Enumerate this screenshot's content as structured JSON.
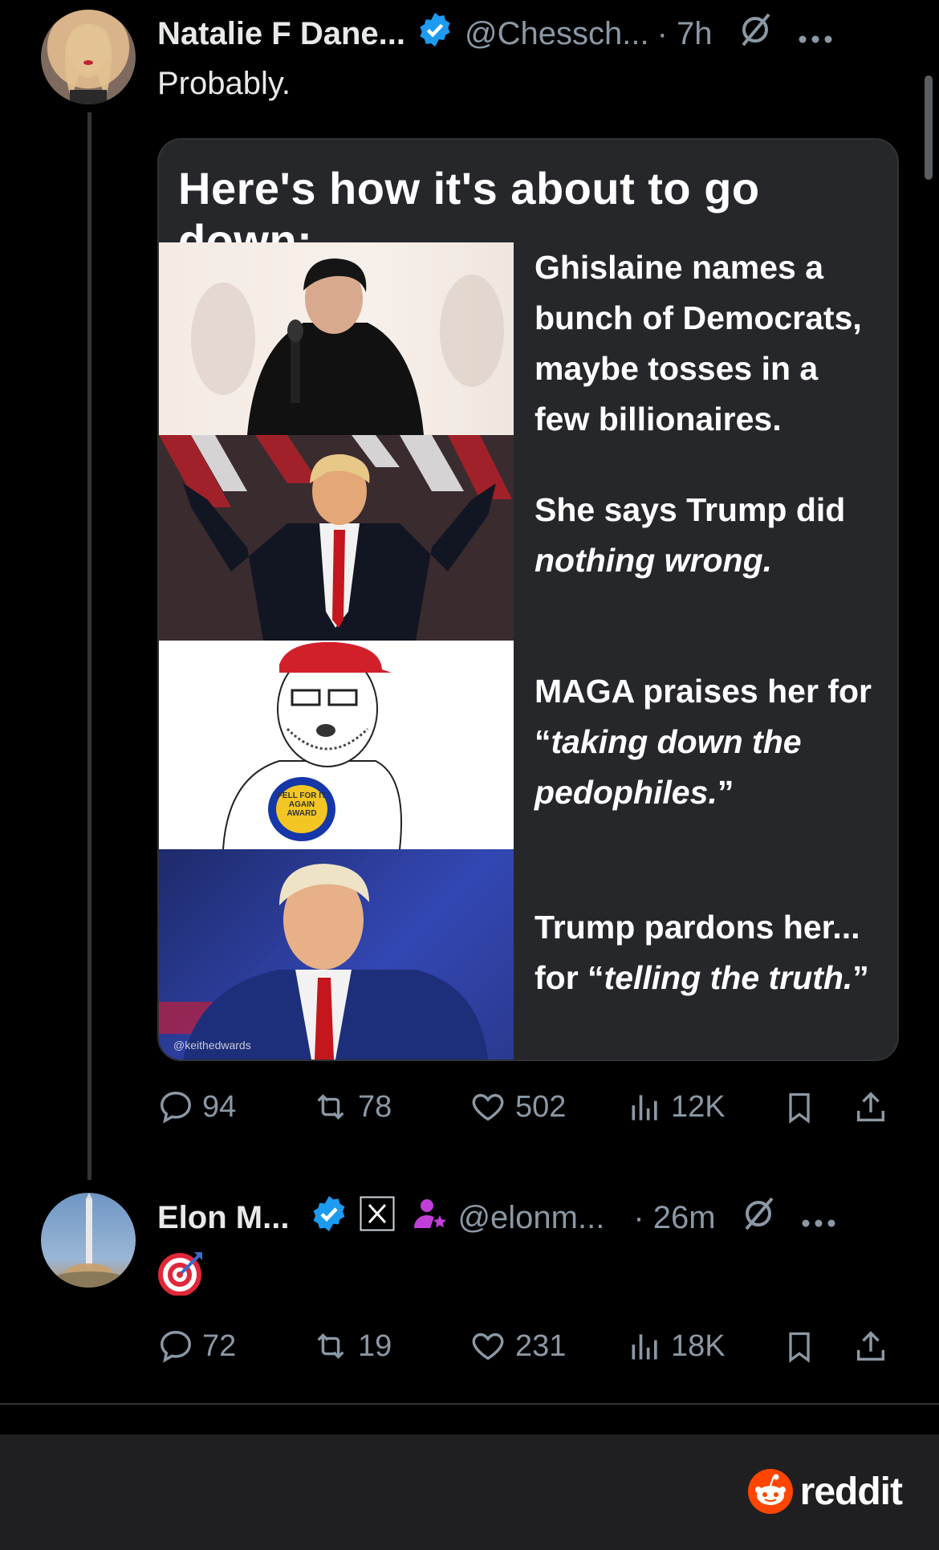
{
  "tweet1": {
    "name": "Natalie F Dane...",
    "handle": "@Chessch...",
    "time": "· 7h",
    "text": "Probably.",
    "media": {
      "title": "Here's how it's about to go down:",
      "panels": [
        {
          "text_plain": "Ghislaine names a bunch of Democrats, maybe tosses in a few billionaires."
        },
        {
          "text_plain": "She says Trump did",
          "text_em": "nothing wrong."
        },
        {
          "text_plain": "MAGA praises her for “",
          "text_em": "taking down the pedophiles.",
          "text_end": "”"
        },
        {
          "text_plain": "Trump pardons her... for “",
          "text_em": "telling the truth.",
          "text_end": "”"
        }
      ],
      "badge_text": "FELL FOR IT AGAIN AWARD",
      "watermark": "@keithedwards"
    },
    "stats": {
      "replies": "94",
      "retweets": "78",
      "likes": "502",
      "views": "12K"
    }
  },
  "tweet2": {
    "name": "Elon M...",
    "handle": "@elonm...",
    "time": "· 26m",
    "emoji": "🎯",
    "stats": {
      "replies": "72",
      "retweets": "19",
      "likes": "231",
      "views": "18K"
    }
  },
  "footer": {
    "brand": "reddit"
  },
  "colors": {
    "background": "#000000",
    "text": "#e7e9ea",
    "muted": "#8b98a5",
    "verified": "#1d9bf0",
    "reddit_orange": "#ff4500"
  }
}
